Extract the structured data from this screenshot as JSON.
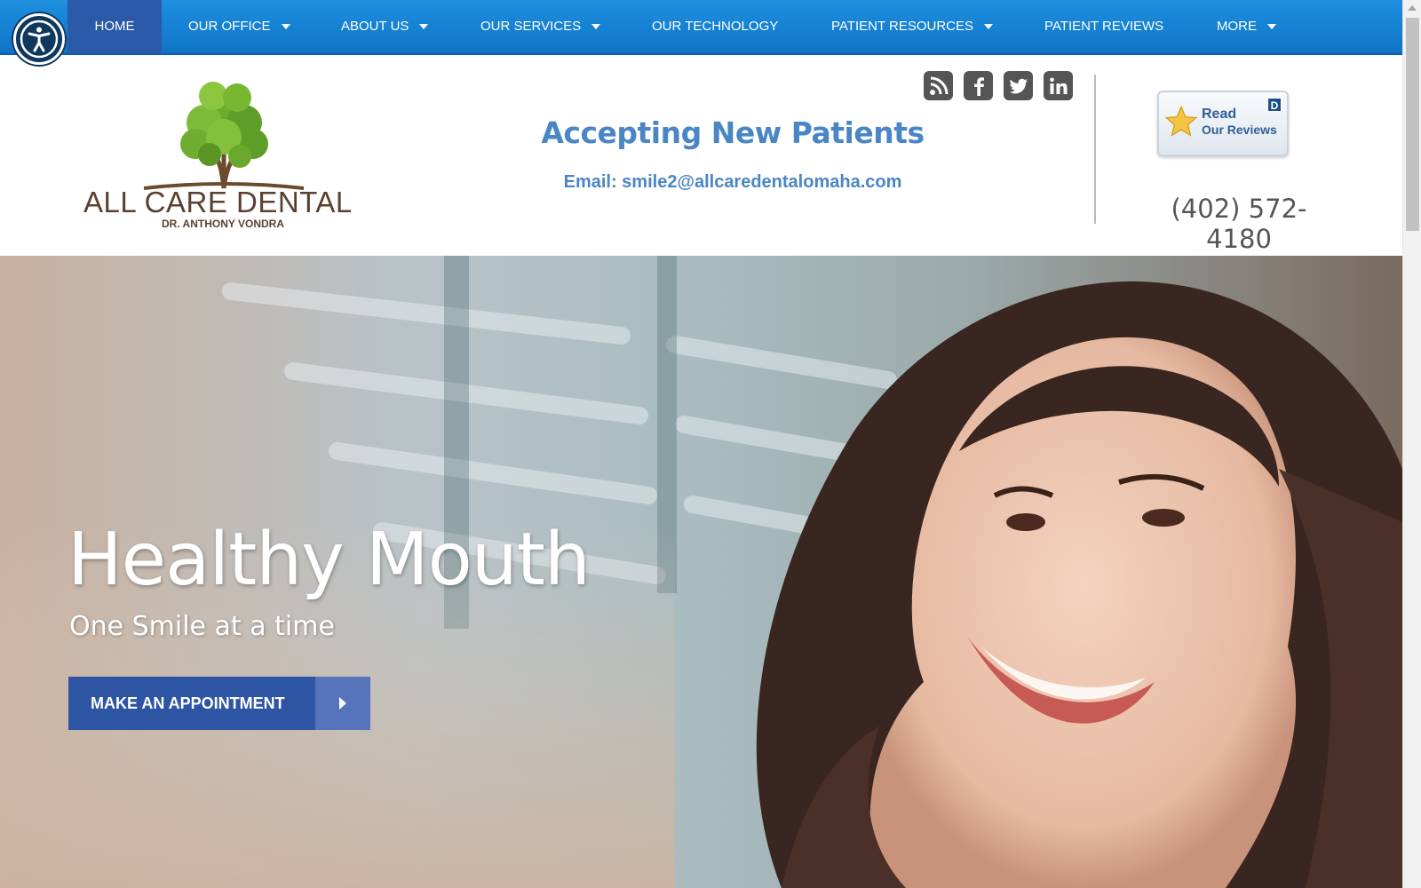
{
  "nav": {
    "items": [
      {
        "label": "HOME",
        "active": true,
        "dropdown": false
      },
      {
        "label": "OUR OFFICE",
        "active": false,
        "dropdown": true
      },
      {
        "label": "ABOUT US",
        "active": false,
        "dropdown": true
      },
      {
        "label": "OUR SERVICES",
        "active": false,
        "dropdown": true
      },
      {
        "label": "OUR TECHNOLOGY",
        "active": false,
        "dropdown": false
      },
      {
        "label": "PATIENT RESOURCES",
        "active": false,
        "dropdown": true
      },
      {
        "label": "PATIENT REVIEWS",
        "active": false,
        "dropdown": false
      },
      {
        "label": "MORE",
        "active": false,
        "dropdown": true
      }
    ],
    "accessibility_icon": "accessibility-person-icon"
  },
  "header": {
    "logo": {
      "name": "ALL CARE DENTAL",
      "subtitle": "DR. ANTHONY VONDRA",
      "icon": "tree-icon"
    },
    "accepting": "Accepting New Patients",
    "email": "Email: smile2@allcaredentalomaha.com",
    "social": [
      {
        "icon": "rss-icon"
      },
      {
        "icon": "facebook-icon"
      },
      {
        "icon": "twitter-icon"
      },
      {
        "icon": "linkedin-icon"
      }
    ],
    "reviews_badge": {
      "line1": "Read",
      "line2": "Our Reviews",
      "mark": "D",
      "icon": "star-icon"
    },
    "phone": "(402) 572-4180"
  },
  "hero": {
    "title": "Healthy Mouth",
    "subtitle": "One Smile at a time",
    "cta_label": "MAKE AN APPOINTMENT",
    "cta_icon": "arrow-right-icon"
  },
  "colors": {
    "nav_bg": "#1581d6",
    "nav_active": "#2a5aa8",
    "accent_blue": "#4a86c5",
    "cta_bg": "#2e54a4",
    "logo_brown": "#5a4030"
  }
}
